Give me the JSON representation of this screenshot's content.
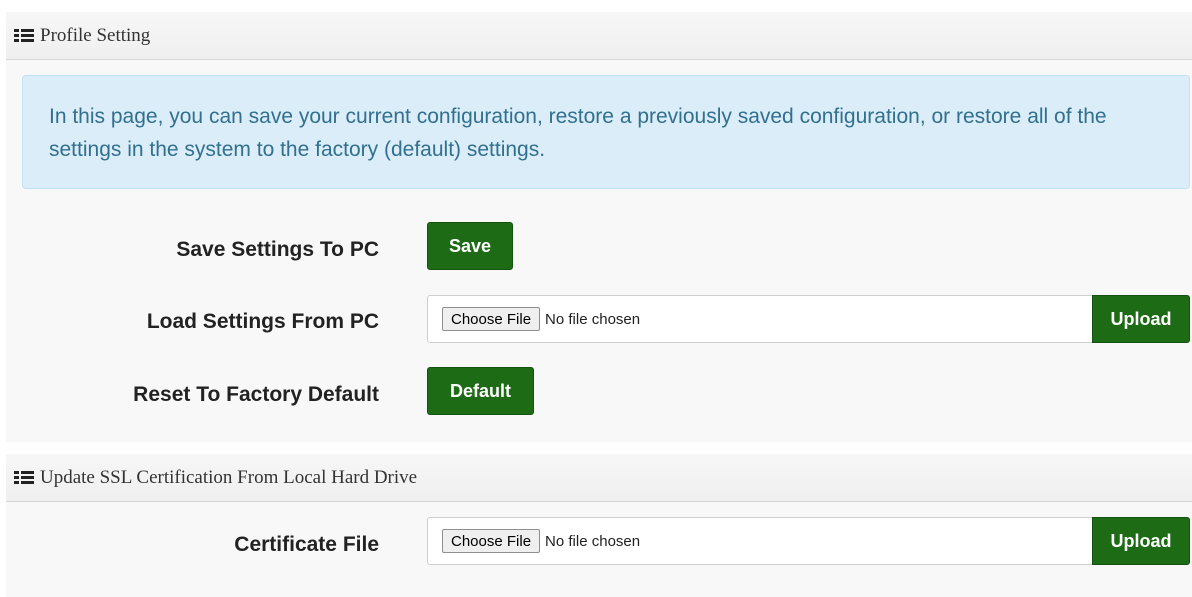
{
  "profile_setting": {
    "heading": "Profile Setting",
    "info": "In this page, you can save your current configuration, restore a previously saved configuration, or restore all of the settings in the system to the factory (default) settings.",
    "save_label": "Save Settings To PC",
    "save_button": "Save",
    "load_label": "Load Settings From PC",
    "load_choose_button": "Choose File",
    "load_file_status": "No file chosen",
    "load_upload_button": "Upload",
    "reset_label": "Reset To Factory Default",
    "reset_button": "Default"
  },
  "ssl": {
    "heading": "Update SSL Certification From Local Hard Drive",
    "cert_label": "Certificate File",
    "cert_choose_button": "Choose File",
    "cert_file_status": "No file chosen",
    "cert_upload_button": "Upload"
  },
  "colors": {
    "button_green": "#1d6b14",
    "info_bg": "#dbedf8",
    "info_text": "#31708f"
  },
  "icons": {
    "section_heading": "list-icon"
  }
}
